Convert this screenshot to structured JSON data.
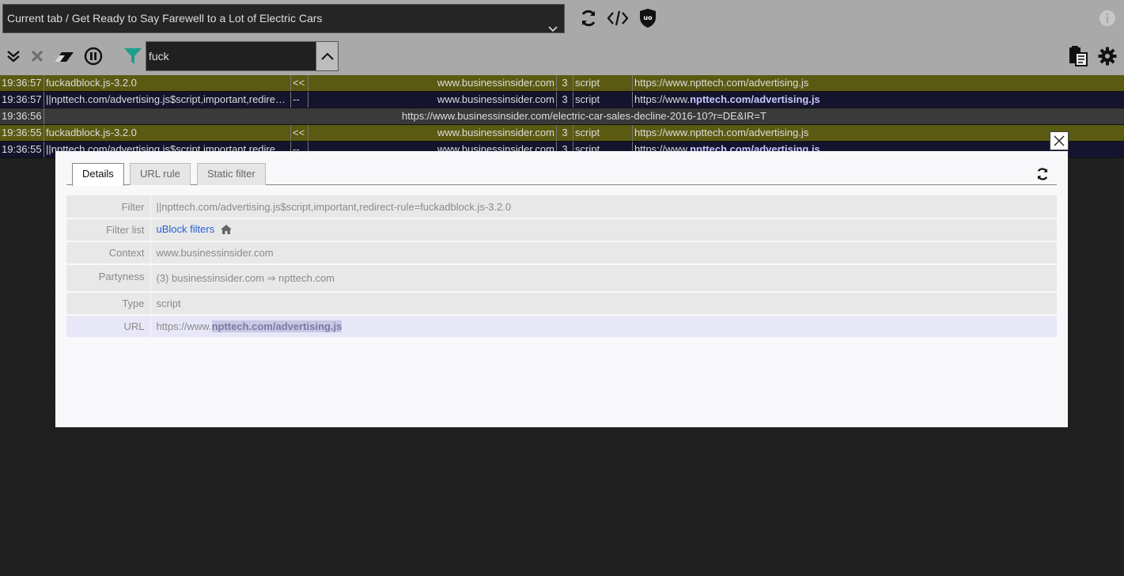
{
  "topbar": {
    "tab_select_value": "Current tab / Get Ready to Say Farewell to a Lot of Electric Cars"
  },
  "toolbar": {
    "filter_value": "fuck"
  },
  "log_rows": [
    {
      "kind": "allowed",
      "time": "19:36:57",
      "filter": "fuckadblock.js-3.2.0",
      "dir": "<<",
      "context": "www.businessinsider.com",
      "party": "3",
      "type": "script",
      "url_prefix": "https://www.npttech.com/advertising.js",
      "url_bold": ""
    },
    {
      "kind": "blocked",
      "time": "19:36:57",
      "filter": "||npttech.com/advertising.js$script,important,redirect-rule=fuckadblock.js-3.2.0",
      "dir": "--",
      "context": "www.businessinsider.com",
      "party": "3",
      "type": "script",
      "url_prefix": "https://www.",
      "url_bold": "npttech.com/advertising.js"
    },
    {
      "kind": "doc",
      "time": "19:36:56",
      "doc_url": "https://www.businessinsider.com/electric-car-sales-decline-2016-10?r=DE&IR=T"
    },
    {
      "kind": "allowed",
      "time": "19:36:55",
      "filter": "fuckadblock.js-3.2.0",
      "dir": "<<",
      "context": "www.businessinsider.com",
      "party": "3",
      "type": "script",
      "url_prefix": "https://www.npttech.com/advertising.js",
      "url_bold": ""
    },
    {
      "kind": "blocked",
      "time": "19:36:55",
      "filter": "||npttech.com/advertising.js$script,important,redirect-rule=fuckadblock.js-3.2.0",
      "dir": "--",
      "context": "www.businessinsider.com",
      "party": "3",
      "type": "script",
      "url_prefix": "https://www.",
      "url_bold": "npttech.com/advertising.js"
    }
  ],
  "modal": {
    "tabs": [
      "Details",
      "URL rule",
      "Static filter"
    ],
    "details": {
      "filter_label": "Filter",
      "filter_value": "||npttech.com/advertising.js$script,important,redirect-rule=fuckadblock.js-3.2.0",
      "filterlist_label": "Filter list",
      "filterlist_value": "uBlock filters",
      "context_label": "Context",
      "context_value": "www.businessinsider.com",
      "partyness_label": "Partyness",
      "partyness_value": "(3) businessinsider.com ⇒ npttech.com",
      "type_label": "Type",
      "type_value": "script",
      "url_label": "URL",
      "url_prefix": "https://www.",
      "url_highlight": "npttech.com/advertising.js"
    }
  },
  "icons": {
    "dropdown": "chevron-down-icon",
    "reload": "refresh-icon",
    "dom": "code-icon",
    "ublock": "ublock-shield-icon",
    "info": "info-icon",
    "expand": "double-chevron-down-icon",
    "clear": "x-icon",
    "erase": "eraser-icon",
    "pause": "pause-icon",
    "filter": "funnel-icon",
    "filter_toggle": "chevron-up-icon",
    "export": "clipboard-icon",
    "settings": "gear-icon",
    "close": "close-icon",
    "modal_reload": "refresh-icon",
    "home": "home-icon"
  },
  "colors": {
    "allowed_row": "#5a5a12",
    "blocked_row": "#14142e",
    "link": "#2a5cd8",
    "filter_icon": "#1c9e8a"
  }
}
